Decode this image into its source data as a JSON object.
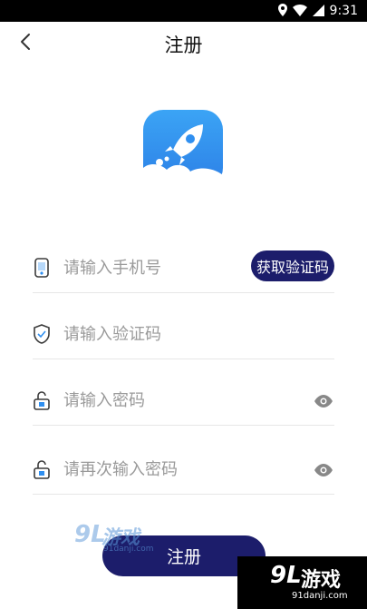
{
  "status_bar": {
    "time": "9:31"
  },
  "header": {
    "title": "注册"
  },
  "form": {
    "phone_placeholder": "请输入手机号",
    "get_code_label": "获取验证码",
    "code_placeholder": "请输入验证码",
    "password_placeholder": "请输入密码",
    "confirm_password_placeholder": "请再次输入密码"
  },
  "register_button_label": "注册",
  "watermark": {
    "brand_mark": "9L",
    "brand_text": "游戏",
    "url": "91danji.com"
  },
  "colors": {
    "primary": "#1c1d6b",
    "logo_blue": "#2f8ff0",
    "status_bar": "#000000"
  },
  "icons": {
    "back": "chevron-left-icon",
    "phone": "phone-icon",
    "code": "shield-icon",
    "password": "lock-icon",
    "eye": "eye-icon"
  }
}
